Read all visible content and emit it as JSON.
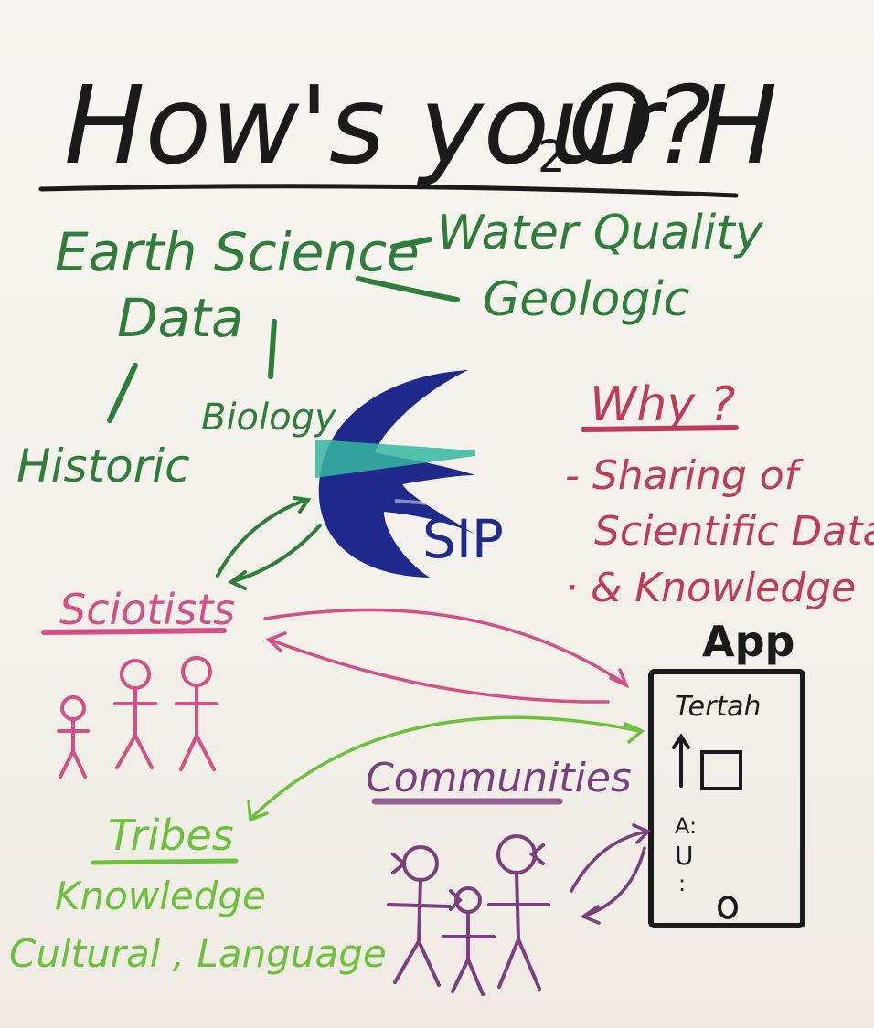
{
  "title": {
    "main": "How's your H",
    "sub": "2",
    "tail": "O?"
  },
  "earth_science": {
    "line1": "Earth Science",
    "line2": "Data"
  },
  "branches": {
    "water_quality": "Water Quality",
    "geologic": "Geologic",
    "biology": "Biology",
    "historic": "Historic"
  },
  "esip_logo": {
    "text": "SIP"
  },
  "why": {
    "heading": "Why ?",
    "bullets": [
      "- Sharing of",
      "Scientific Data",
      "· & Knowledge"
    ]
  },
  "scientists": {
    "label": "Sciotists"
  },
  "app": {
    "label": "App",
    "screen_title": "Tertah",
    "row_text": "A:",
    "row_text2": "U",
    "row_text3": ":"
  },
  "communities": {
    "label": "Communities"
  },
  "tribes": {
    "label": "Tribes",
    "line2": "Knowledge",
    "line3": "Cultural , Language"
  },
  "colors": {
    "black": "#1b1a1a",
    "green": "#2f7d3b",
    "blue": "#1f2a8c",
    "teal": "#36b7a0",
    "pink": "#d54f86",
    "red": "#c23a5a",
    "purple": "#7b3e7e",
    "lime": "#6bc23a"
  }
}
